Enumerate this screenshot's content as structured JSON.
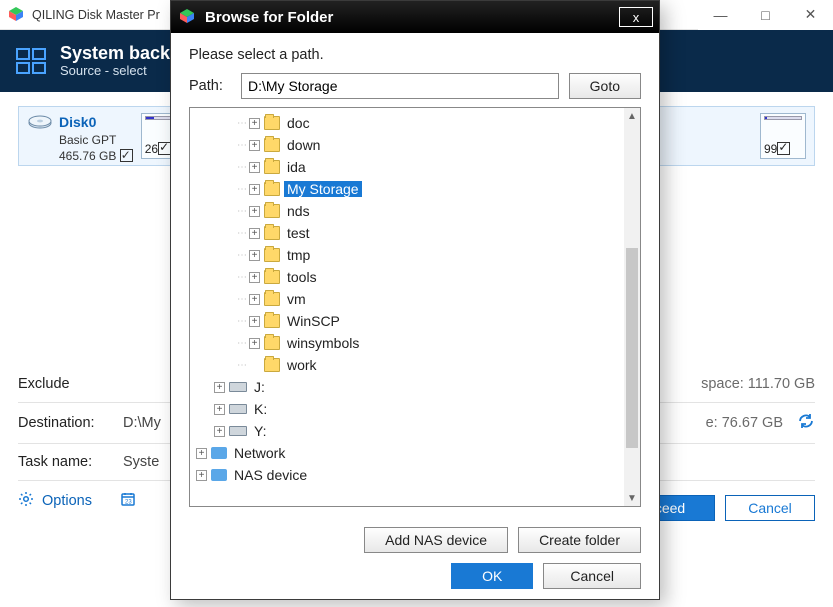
{
  "app": {
    "title": "QILING Disk Master Pr",
    "windowControls": {
      "min": "—",
      "max": "□",
      "close": "✕"
    }
  },
  "ribbon": {
    "title": "System back",
    "subtitle": "Source - select"
  },
  "disk": {
    "name": "Disk0",
    "type": "Basic GPT",
    "size": "465.76 GB",
    "partLeft": {
      "pct": "26",
      "fill": 22
    },
    "partRight": {
      "pct": "99",
      "fill": 6
    }
  },
  "backForm": {
    "excludeLabel": "Exclude",
    "spaceLabel": "space: 111.70 GB",
    "destLabel": "Destination:",
    "destValue": "D:\\My",
    "destFree": "e: 76.67 GB",
    "taskLabel": "Task name:",
    "taskValue": "Syste",
    "optionsLabel": "Options",
    "proceed": "ceed",
    "cancel": "Cancel"
  },
  "dialog": {
    "title": "Browse for Folder",
    "instruction": "Please select a path.",
    "pathLabel": "Path:",
    "pathValue": "D:\\My Storage",
    "goto": "Goto",
    "addNas": "Add NAS device",
    "createFolder": "Create folder",
    "ok": "OK",
    "cancel": "Cancel",
    "close": "x"
  },
  "tree": {
    "folders": [
      "doc",
      "down",
      "ida",
      "My Storage",
      "nds",
      "test",
      "tmp",
      "tools",
      "vm",
      "WinSCP",
      "winsymbols",
      "work"
    ],
    "selected": "My Storage",
    "leaf": "work",
    "drives": [
      "J:",
      "K:",
      "Y:"
    ],
    "roots": [
      "Network",
      "NAS device"
    ]
  }
}
